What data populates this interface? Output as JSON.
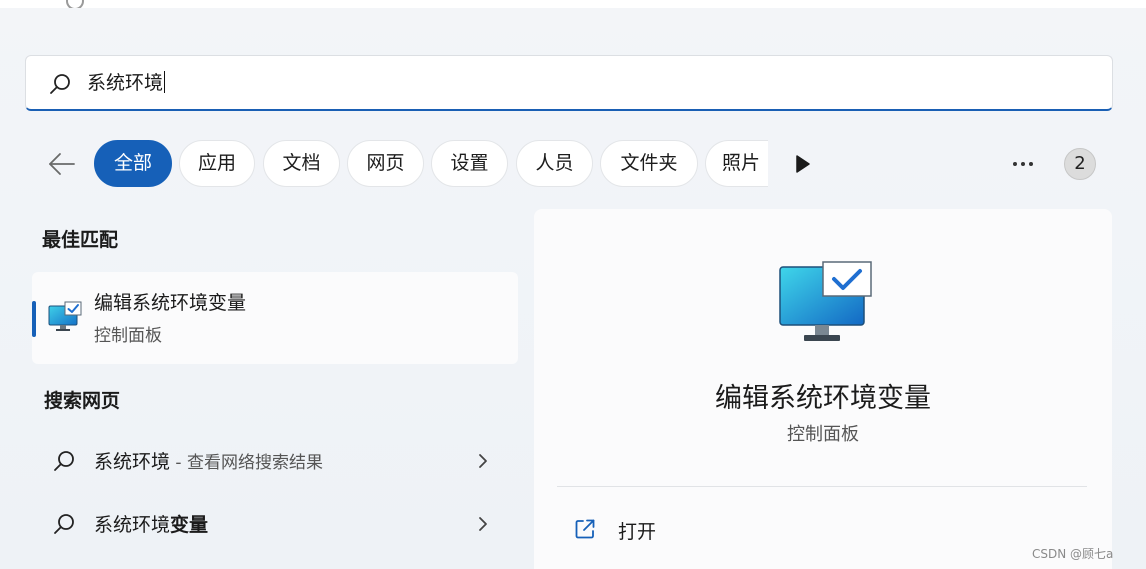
{
  "search": {
    "query": "系统环境"
  },
  "filters": {
    "items": [
      {
        "label": "全部",
        "active": true
      },
      {
        "label": "应用",
        "active": false
      },
      {
        "label": "文档",
        "active": false
      },
      {
        "label": "网页",
        "active": false
      },
      {
        "label": "设置",
        "active": false
      },
      {
        "label": "人员",
        "active": false
      },
      {
        "label": "文件夹",
        "active": false
      },
      {
        "label": "照片",
        "active": false
      }
    ],
    "more_icon": "ellipsis-icon",
    "badge": "2"
  },
  "best_match": {
    "section_title": "最佳匹配",
    "item": {
      "title": "编辑系统环境变量",
      "subtitle": "控制面板",
      "icon": "monitor-check-icon"
    }
  },
  "web_search": {
    "section_title": "搜索网页",
    "items": [
      {
        "query": "系统环境",
        "suffix": " - 查看网络搜索结果"
      },
      {
        "query_plain": "系统环境",
        "query_bold": "变量"
      }
    ]
  },
  "preview": {
    "title": "编辑系统环境变量",
    "subtitle": "控制面板",
    "actions": [
      {
        "label": "打开",
        "icon": "open-external-icon"
      }
    ]
  },
  "watermark": "CSDN @顾七a",
  "colors": {
    "accent": "#1660b8",
    "background": "#f3f5f8",
    "panel": "#fbfbfc"
  }
}
